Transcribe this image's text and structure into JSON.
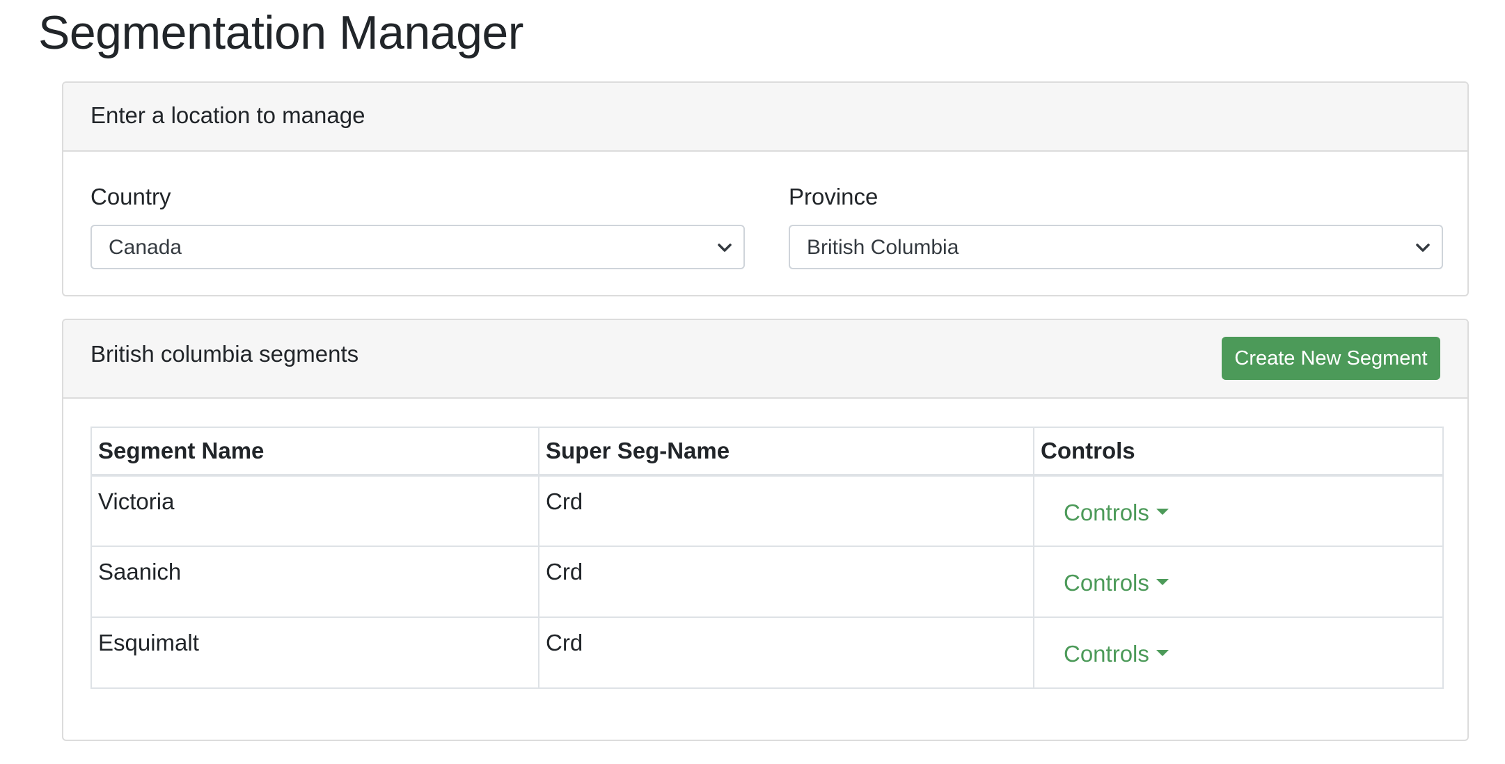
{
  "page": {
    "title": "Segmentation Manager"
  },
  "location_card": {
    "header": "Enter a location to manage",
    "country": {
      "label": "Country",
      "selected": "Canada"
    },
    "province": {
      "label": "Province",
      "selected": "British Columbia"
    }
  },
  "segments_card": {
    "header": "British columbia segments",
    "create_button": "Create New Segment",
    "columns": [
      "Segment Name",
      "Super Seg-Name",
      "Controls"
    ],
    "rows": [
      {
        "segment_name": "Victoria",
        "super_seg_name": "Crd",
        "controls_label": "Controls"
      },
      {
        "segment_name": "Saanich",
        "super_seg_name": "Crd",
        "controls_label": "Controls"
      },
      {
        "segment_name": "Esquimalt",
        "super_seg_name": "Crd",
        "controls_label": "Controls"
      }
    ]
  },
  "colors": {
    "accent_green": "#4c9a59",
    "header_bg": "#f6f6f6",
    "border": "#dcdcdc"
  },
  "icons": {
    "select_chevron": "chevron-down-icon",
    "dropdown_caret": "caret-down-icon"
  }
}
